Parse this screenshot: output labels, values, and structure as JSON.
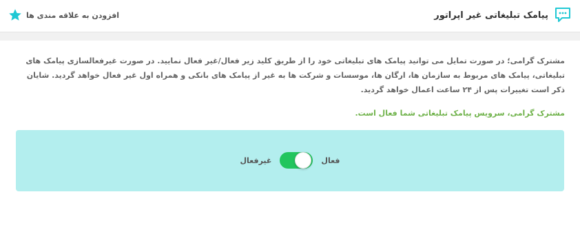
{
  "header": {
    "title": "پیامک تبلیغاتی غیر اپراتور",
    "title_icon": "chat-bubble-icon",
    "favorite_label": "افزودن به علاقه مندی ها",
    "favorite_icon": "star-icon"
  },
  "main": {
    "description": "مشترک گرامی؛ در صورت تمایل می توانید پیامک های تبلیغاتی خود را از طریق کلید زیر فعال/غیر فعال نمایید. در صورت غیرفعالسازی پیامک های تبلیغاتی، پیامک های مربوط به سازمان ها، ارگان ها، موسسات و شرکت ها به غیر از پیامک های بانکی و همراه اول غیر فعال خواهد گردید. شایان ذکر است تغییرات پس از ۲۴ ساعت اعمال خواهد گردید.",
    "status_message": "مشترک گرامی، سرویس پیامک تبلیغاتی شما فعال است.",
    "toggle": {
      "on_label": "فعال",
      "off_label": "غیرفعال",
      "state": "on"
    }
  },
  "colors": {
    "accent": "#1fc8d4",
    "star": "#1fc8d4",
    "status_text": "#6fb24a",
    "panel_bg": "#b3eeee",
    "toggle_on": "#22c55e"
  }
}
